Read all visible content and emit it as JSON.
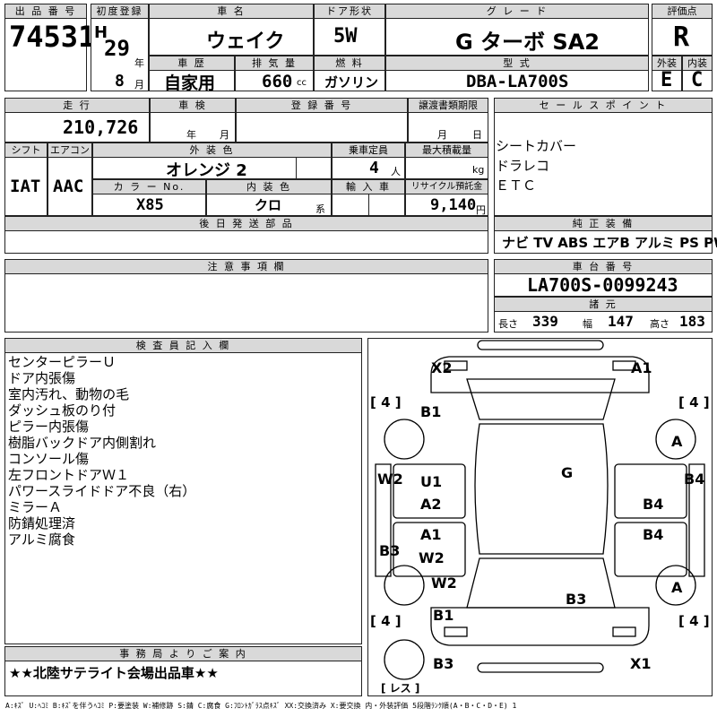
{
  "header": {
    "lot_no_label": "出 品 番 号",
    "lot_no": "74531",
    "first_reg_label": "初度登録",
    "era": "H",
    "year": "29",
    "year_unit": "年",
    "month": "8",
    "month_unit": "月",
    "car_name_label": "車 名",
    "car_name": "ウェイク",
    "door_label": "ドア形状",
    "door": "5W",
    "grade_label": "グ レ ー ド",
    "grade": "G ターボ SA2",
    "score_label": "評価点",
    "score": "R",
    "history_label": "車 歴",
    "history": "自家用",
    "displacement_label": "排 気 量",
    "displacement": "660",
    "displacement_unit": "cc",
    "fuel_label": "燃 料",
    "fuel": "ガソリン",
    "model_label": "型 式",
    "model": "DBA-LA700S",
    "exterior_label": "外装",
    "exterior": "E",
    "interior_label": "内装",
    "interior": "C"
  },
  "row2": {
    "mileage_label": "走 行",
    "mileage": "210,726 km",
    "inspection_label": "車 検",
    "inspection_year_unit": "年",
    "inspection_month_unit": "月",
    "reg_no_label": "登 録 番 号",
    "transfer_label": "譲渡書類期限",
    "transfer_month_unit": "月",
    "transfer_day_unit": "日",
    "shift_label": "シフト",
    "shift": "IAT",
    "ac_label": "エアコン",
    "ac": "AAC",
    "ext_color_label": "外 装 色",
    "ext_color": "オレンジ 2",
    "capacity_label": "乗車定員",
    "capacity": "4",
    "capacity_unit": "人",
    "load_label": "最大積載量",
    "load_unit": "kg",
    "color_no_label": "カ ラ ー No.",
    "color_no": "X85",
    "int_color_label": "内 装 色",
    "int_color": "クロ",
    "int_color_unit": "系",
    "import_label": "輸 入 車",
    "recycle_label": "リサイクル預託金",
    "recycle": "9,140",
    "recycle_unit": "円",
    "parts_label": "後 日 発 送 部 品"
  },
  "sales": {
    "label": "セ ー ル ス ポ イ ン ト",
    "points": [
      "シートカバー",
      "ドラレコ",
      "ＥＴＣ"
    ]
  },
  "equipment": {
    "label": "純 正 装 備",
    "items": "ナビ  TV  ABS  エアB  アルミ  PS  PW"
  },
  "notes": {
    "label": "注 意 事 項 欄"
  },
  "chassis": {
    "label": "車 台 番 号",
    "number": "LA700S-0099243",
    "spec_label": "諸 元",
    "length_label": "長さ",
    "length": "339",
    "width_label": "幅",
    "width": "147",
    "height_label": "高さ",
    "height": "183"
  },
  "inspector": {
    "label": "検 査 員 記 入 欄",
    "lines": [
      "センターピラーＵ",
      "ドア内張傷",
      "室内汚れ、動物の毛",
      "ダッシュ板のり付",
      "ピラー内張傷",
      "樹脂バックドア内側割れ",
      "コンソール傷",
      "左フロントドアＷ１",
      "パワースライドドア不良（右）",
      "ミラーＡ",
      "防錆処理済",
      "アルミ腐食"
    ]
  },
  "office": {
    "label": "事 務 局 よ り ご 案 内",
    "message": "★★北陸サテライト会場出品車★★"
  },
  "diagram": {
    "marks": {
      "x2": "X2",
      "a1_top": "A1",
      "b1_top": "B1",
      "a_right_top": "A",
      "g": "G",
      "w2_left": "W2",
      "u1": "U1",
      "b4_right_edge": "B4",
      "a2": "A2",
      "b4_a": "B4",
      "b3_left": "B3",
      "a1_mid": "A1",
      "b4_b": "B4",
      "w2_mid": "W2",
      "w2_low": "W2",
      "a_right_low": "A",
      "b3_mid": "B3",
      "b1_low": "B1",
      "b3_bottom": "B3",
      "x1": "X1"
    },
    "tire_left_top": "[ 4 ]",
    "tire_right_top": "[ 4 ]",
    "tire_left_bottom": "[ 4 ]",
    "tire_right_bottom": "[ 4 ]",
    "spare": "[ レス ]"
  },
  "legend": "A:ｷｽﾞ U:ﾍｺﾐ B:ｷｽﾞを伴うﾍｺﾐ P:要塗装 W:補修跡 S:錆 C:腐食 G:ﾌﾛﾝﾄｶﾞﾗｽ点ｷｽﾞ XX:交換済み X:要交換 内・外装評価 5段階ﾗﾝｸ順(A・B・C・D・E) 1"
}
